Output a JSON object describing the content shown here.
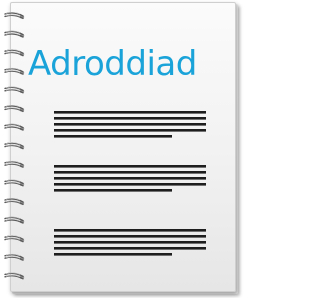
{
  "document": {
    "title": "Adroddiad",
    "accent_color": "#1aa3d9",
    "text_line_color": "#1e1e1e",
    "binding": "spiral-rings",
    "text_blocks": [
      {
        "lines": 5
      },
      {
        "lines": 5
      },
      {
        "lines": 5
      }
    ]
  }
}
